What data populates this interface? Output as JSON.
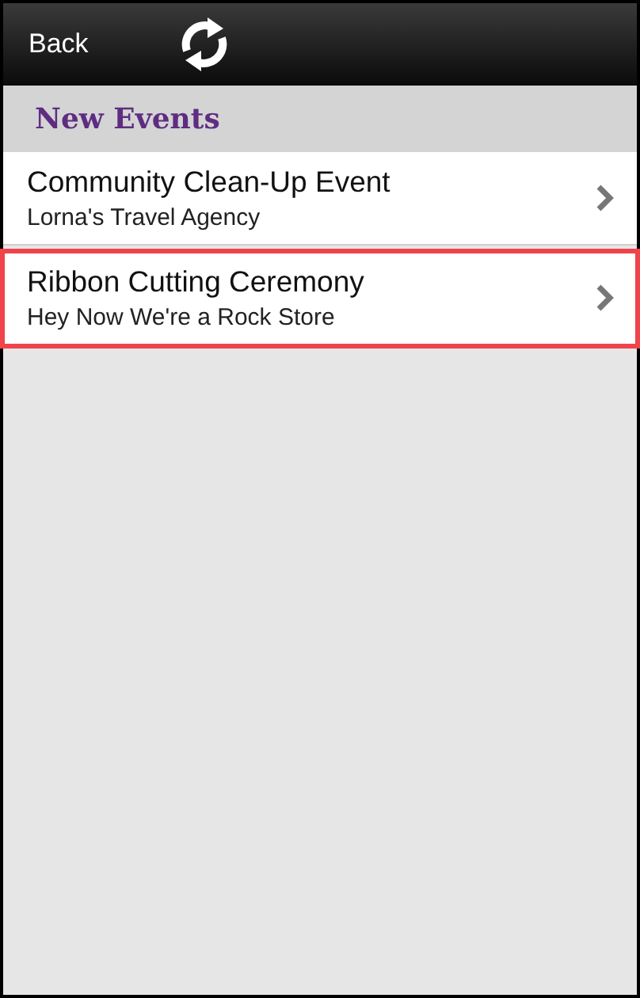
{
  "header": {
    "back_label": "Back"
  },
  "section": {
    "title": "New Events"
  },
  "events": [
    {
      "title": "Community Clean-Up Event",
      "subtitle": "Lorna's Travel Agency",
      "highlighted": false
    },
    {
      "title": "Ribbon Cutting Ceremony",
      "subtitle": "Hey Now We're a Rock Store",
      "highlighted": true
    }
  ]
}
